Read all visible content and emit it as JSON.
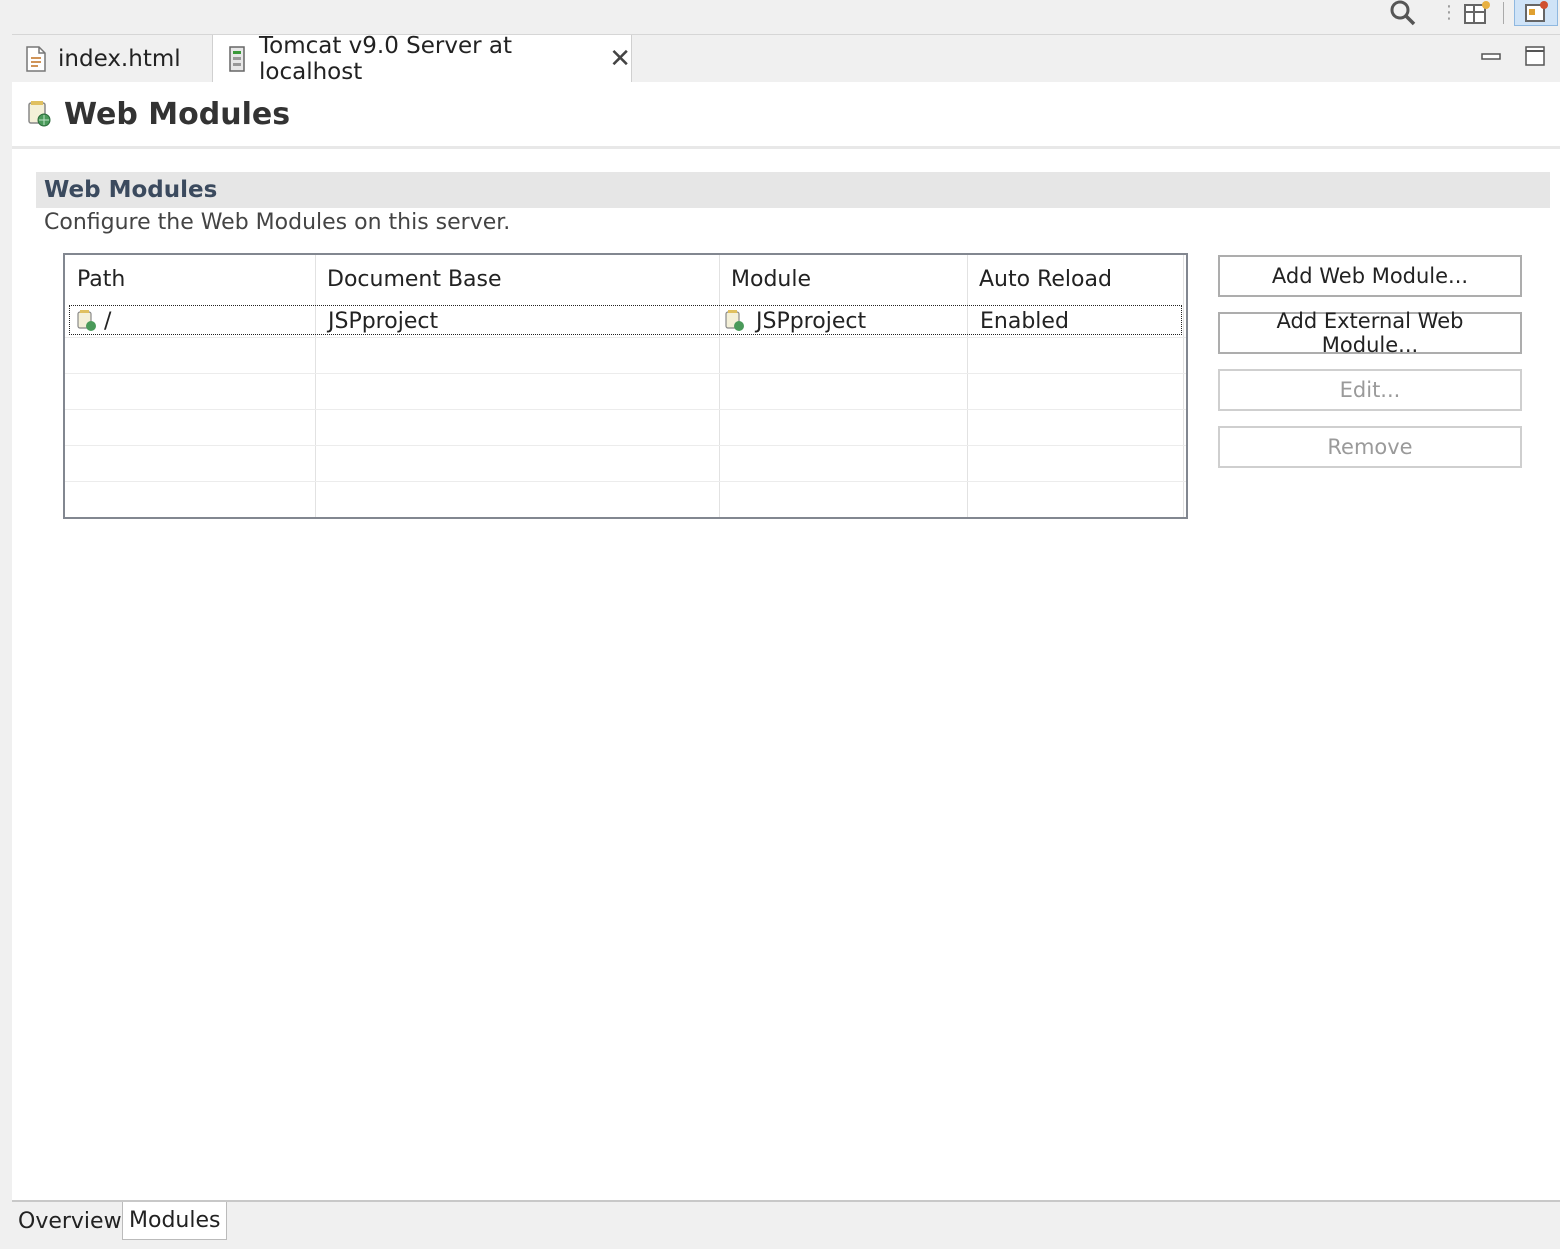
{
  "tabs": {
    "file_tab_label": "index.html",
    "server_tab_label": "Tomcat v9.0 Server at localhost"
  },
  "page": {
    "title": "Web Modules"
  },
  "section": {
    "title": "Web Modules",
    "description": "Configure the Web Modules on this server."
  },
  "table": {
    "columns": [
      "Path",
      "Document Base",
      "Module",
      "Auto Reload"
    ],
    "rows": [
      {
        "path": "/",
        "document_base": "JSPproject",
        "module": "JSPproject",
        "auto_reload": "Enabled"
      }
    ]
  },
  "buttons": {
    "add_web_module": "Add Web Module...",
    "add_external_web_module": "Add External Web Module...",
    "edit": "Edit...",
    "remove": "Remove"
  },
  "bottom_tabs": [
    "Overview",
    "Modules"
  ],
  "icons": {
    "search": "search-icon",
    "perspective": "open-perspective-icon",
    "javaee": "javaee-perspective-icon",
    "file": "html-file-icon",
    "server": "server-icon",
    "web_module": "web-module-icon",
    "close": "close-icon",
    "minimize": "minimize-icon",
    "maximize": "maximize-icon"
  }
}
